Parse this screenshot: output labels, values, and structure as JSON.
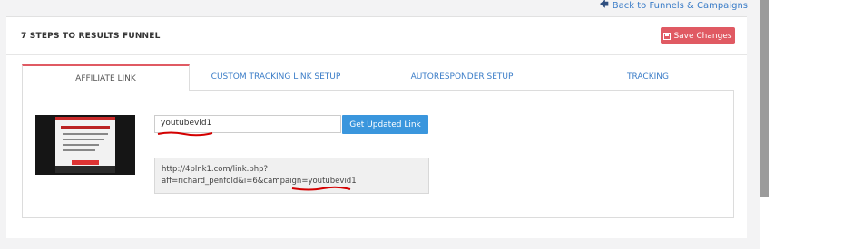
{
  "header": {
    "back_link_label": "Back to Funnels & Campaigns"
  },
  "panel": {
    "title": "7 STEPS TO RESULTS FUNNEL",
    "save_label": "Save Changes"
  },
  "tabs": [
    {
      "label": "AFFILIATE LINK",
      "active": true
    },
    {
      "label": "CUSTOM TRACKING LINK SETUP",
      "active": false
    },
    {
      "label": "AUTORESPONDER SETUP",
      "active": false
    },
    {
      "label": "TRACKING",
      "active": false
    }
  ],
  "affiliate": {
    "campaign_input_value": "youtubevid1",
    "update_button_label": "Get Updated Link",
    "result_line1": "http://4plnk1.com/link.php?",
    "result_line2_prefix": "aff=richard_penfold&i=6&campaign=",
    "result_line2_campaign": "youtubevid1"
  },
  "colors": {
    "accent_red": "#e05a63",
    "button_blue": "#3a96dd",
    "link_blue": "#3a7cc7"
  }
}
